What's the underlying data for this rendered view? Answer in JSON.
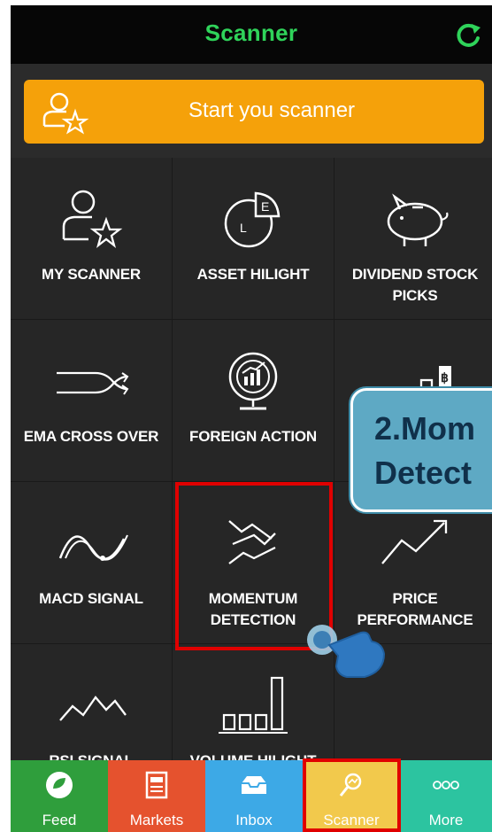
{
  "header": {
    "title": "Scanner",
    "refresh_icon": "refresh-icon"
  },
  "start_button": {
    "label": "Start you scanner",
    "icon": "user-star-icon"
  },
  "grid": [
    {
      "label_line1": "MY SCANNER",
      "label_line2": "",
      "icon": "user-star-icon"
    },
    {
      "label_line1": "ASSET HILIGHT",
      "label_line2": "",
      "icon": "pie-chart-icon"
    },
    {
      "label_line1": "DIVIDEND STOCK",
      "label_line2": "PICKS",
      "icon": "piggy-bank-icon"
    },
    {
      "label_line1": "EMA CROSS OVER",
      "label_line2": "",
      "icon": "cross-over-icon"
    },
    {
      "label_line1": "FOREIGN ACTION",
      "label_line2": "",
      "icon": "globe-chart-icon"
    },
    {
      "label_line1": "",
      "label_line2": "",
      "icon": "bitcoin-bars-icon"
    },
    {
      "label_line1": "MACD SIGNAL",
      "label_line2": "",
      "icon": "wave-icon"
    },
    {
      "label_line1": "MOMENTUM",
      "label_line2": "DETECTION",
      "icon": "momentum-icon"
    },
    {
      "label_line1": "PRICE",
      "label_line2": "PERFORMANCE",
      "icon": "trend-up-icon"
    },
    {
      "label_line1": "RSI SIGNAL",
      "label_line2": "",
      "icon": "zigzag-icon"
    },
    {
      "label_line1": "VOLUME HILIGHT",
      "label_line2": "",
      "icon": "volume-bars-icon"
    }
  ],
  "callout": {
    "line1": "2.Mom",
    "line2": "Detect"
  },
  "tabs": [
    {
      "label": "Feed",
      "color": "#2f9e3c",
      "icon": "leaf-icon"
    },
    {
      "label": "Markets",
      "color": "#e5522e",
      "icon": "newspaper-icon"
    },
    {
      "label": "Inbox",
      "color": "#3da9e6",
      "icon": "inbox-icon"
    },
    {
      "label": "Scanner",
      "color": "#f2c94c",
      "icon": "scanner-icon"
    },
    {
      "label": "More",
      "color": "#2cc4a0",
      "icon": "more-icon"
    }
  ],
  "colors": {
    "accent": "#2fd35a",
    "button": "#f5a10a",
    "highlight": "#e00000"
  }
}
